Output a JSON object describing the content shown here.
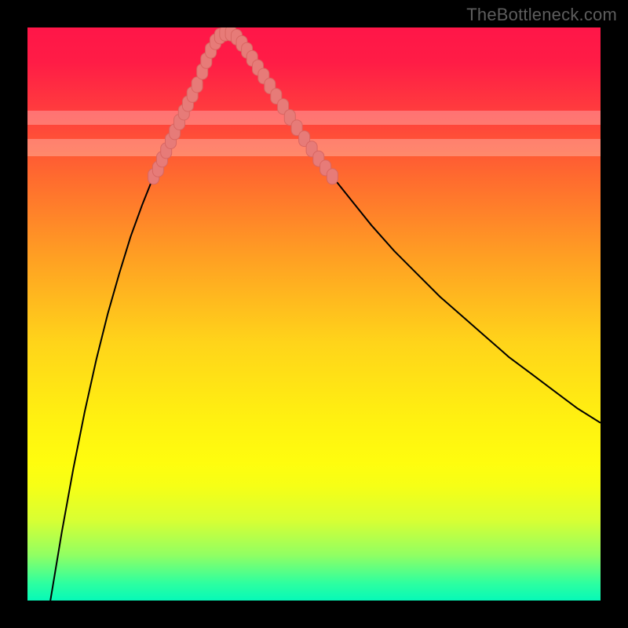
{
  "watermark": "TheBottleneck.com",
  "colors": {
    "black": "#000000",
    "curve": "#000000",
    "marker_fill": "#e77b78",
    "marker_stroke": "#d86662"
  },
  "chart_data": {
    "type": "line",
    "title": "",
    "xlabel": "",
    "ylabel": "",
    "xlim": [
      0,
      100
    ],
    "ylim": [
      0,
      100
    ],
    "grid": false,
    "legend": false,
    "pale_bands_y": [
      {
        "ymin": 77.5,
        "ymax": 80.5
      },
      {
        "ymin": 83.0,
        "ymax": 85.5
      }
    ],
    "series": [
      {
        "name": "bottleneck-curve",
        "x": [
          4,
          6,
          8,
          10,
          12,
          14,
          16,
          18,
          20,
          22,
          24,
          26,
          28,
          29,
          30,
          31,
          32,
          33,
          34,
          35,
          36,
          38,
          40,
          44,
          48,
          52,
          56,
          60,
          64,
          68,
          72,
          76,
          80,
          84,
          88,
          92,
          96,
          100
        ],
        "y": [
          0,
          12,
          23,
          33,
          42,
          50,
          57,
          63.5,
          69,
          74,
          78.5,
          82.5,
          86,
          88,
          90.5,
          93,
          95.5,
          97.5,
          98.5,
          99,
          98.5,
          96.5,
          93.5,
          87,
          81,
          75.5,
          70.5,
          65.5,
          61,
          57,
          53,
          49.5,
          46,
          42.5,
          39.5,
          36.5,
          33.5,
          31
        ]
      }
    ],
    "marker_segments": [
      {
        "name": "left-arm-markers",
        "points": [
          {
            "x": 22.0,
            "y": 74.0
          },
          {
            "x": 22.8,
            "y": 75.3
          },
          {
            "x": 23.5,
            "y": 77.0
          },
          {
            "x": 24.2,
            "y": 78.5
          },
          {
            "x": 25.0,
            "y": 80.2
          },
          {
            "x": 25.7,
            "y": 81.8
          },
          {
            "x": 26.5,
            "y": 83.5
          },
          {
            "x": 27.3,
            "y": 85.2
          },
          {
            "x": 28.0,
            "y": 86.7
          },
          {
            "x": 28.8,
            "y": 88.3
          },
          {
            "x": 29.6,
            "y": 90.0
          }
        ]
      },
      {
        "name": "trough-markers",
        "points": [
          {
            "x": 30.5,
            "y": 92.3
          },
          {
            "x": 31.2,
            "y": 94.2
          },
          {
            "x": 32.0,
            "y": 96.0
          },
          {
            "x": 32.8,
            "y": 97.5
          },
          {
            "x": 33.6,
            "y": 98.5
          },
          {
            "x": 34.5,
            "y": 99.0
          },
          {
            "x": 35.5,
            "y": 99.0
          },
          {
            "x": 36.5,
            "y": 98.3
          },
          {
            "x": 37.4,
            "y": 97.2
          },
          {
            "x": 38.3,
            "y": 96.0
          }
        ]
      },
      {
        "name": "right-arm-markers",
        "points": [
          {
            "x": 39.2,
            "y": 94.6
          },
          {
            "x": 40.2,
            "y": 93.0
          },
          {
            "x": 41.2,
            "y": 91.5
          },
          {
            "x": 42.3,
            "y": 89.8
          },
          {
            "x": 43.4,
            "y": 88.0
          },
          {
            "x": 44.6,
            "y": 86.2
          },
          {
            "x": 45.8,
            "y": 84.3
          },
          {
            "x": 47.0,
            "y": 82.5
          },
          {
            "x": 48.3,
            "y": 80.6
          },
          {
            "x": 49.6,
            "y": 78.8
          },
          {
            "x": 50.8,
            "y": 77.1
          },
          {
            "x": 52.0,
            "y": 75.5
          },
          {
            "x": 53.2,
            "y": 74.0
          }
        ]
      }
    ]
  }
}
